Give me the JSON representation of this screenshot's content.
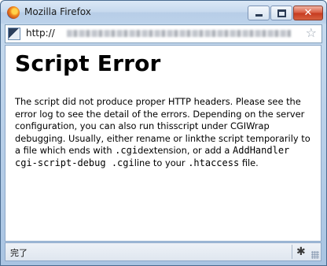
{
  "window": {
    "title": "Mozilla Firefox",
    "buttons": {
      "minimize": "minimize-icon",
      "maximize": "maximize-icon",
      "close": "close-icon"
    },
    "close_glyph": "✕"
  },
  "navbar": {
    "url_prefix": "http://",
    "bookmark_glyph": "☆"
  },
  "page": {
    "title": "Script Error",
    "text_1": "The script did not produce proper HTTP headers. Please see the error log to see the detail of the errors. Depending on the server configuration, you can also run thisscript under CGIWrap debugging. Usually, either rename or linkthe script temporarily to a file which ends with ",
    "code_1": ".cgi",
    "text_2": "dextension, or add a ",
    "code_2": "AddHandler cgi-script-debug .cgi",
    "text_3": "line to your ",
    "code_3": ".htaccess",
    "text_4": " file."
  },
  "statusbar": {
    "text": "完了",
    "addon_glyph": "✱"
  },
  "colors": {
    "title_bar": "#c6d9ee",
    "close_button": "#c63a1f",
    "border": "#4a6b8f"
  }
}
